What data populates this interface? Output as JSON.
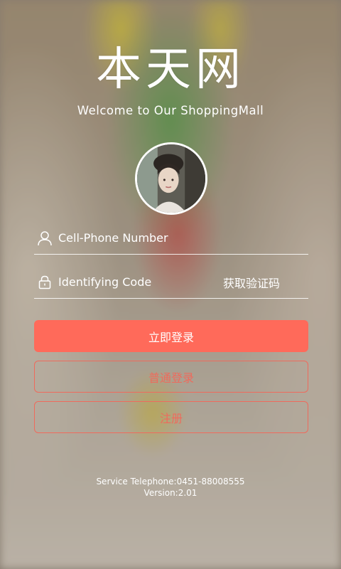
{
  "header": {
    "brand": "本天网",
    "tagline": "Welcome to Our ShoppingMall"
  },
  "avatar": {
    "icon": "user-photo"
  },
  "form": {
    "phone": {
      "placeholder": "Cell-Phone Number",
      "value": "",
      "icon": "user-icon"
    },
    "code": {
      "placeholder": "Identifying Code",
      "value": "",
      "icon": "lock-icon"
    },
    "get_code_label": "获取验证码"
  },
  "buttons": {
    "login_now": "立即登录",
    "normal_login": "普通登录",
    "register": "注册"
  },
  "footer": {
    "service": "Service Telephone:0451-88008555",
    "version": "Version:2.01"
  },
  "colors": {
    "accent": "#ff6a5a",
    "outline": "#ef6a5c",
    "text": "#ffffff"
  }
}
